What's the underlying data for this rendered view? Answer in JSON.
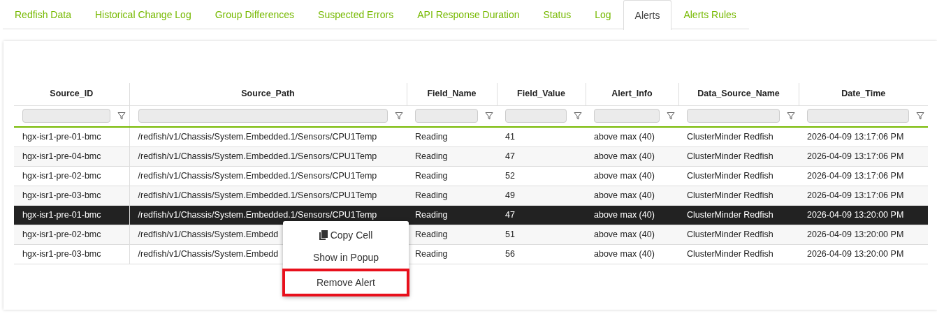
{
  "tabs": [
    {
      "label": "Redfish Data",
      "selected": false
    },
    {
      "label": "Historical Change Log",
      "selected": false
    },
    {
      "label": "Group Differences",
      "selected": false
    },
    {
      "label": "Suspected Errors",
      "selected": false
    },
    {
      "label": "API Response Duration",
      "selected": false
    },
    {
      "label": "Status",
      "selected": false
    },
    {
      "label": "Log",
      "selected": false
    },
    {
      "label": "Alerts",
      "selected": true
    },
    {
      "label": "Alerts Rules",
      "selected": false
    }
  ],
  "table": {
    "columns": [
      "Source_ID",
      "Source_Path",
      "Field_Name",
      "Field_Value",
      "Alert_Info",
      "Data_Source_Name",
      "Date_Time"
    ],
    "rows": [
      {
        "selected": false,
        "cells": [
          "hgx-isr1-pre-01-bmc",
          "/redfish/v1/Chassis/System.Embedded.1/Sensors/CPU1Temp",
          "Reading",
          "41",
          "above max (40)",
          "ClusterMinder Redfish",
          "2026-04-09 13:17:06 PM"
        ]
      },
      {
        "selected": false,
        "cells": [
          "hgx-isr1-pre-04-bmc",
          "/redfish/v1/Chassis/System.Embedded.1/Sensors/CPU1Temp",
          "Reading",
          "47",
          "above max (40)",
          "ClusterMinder Redfish",
          "2026-04-09 13:17:06 PM"
        ]
      },
      {
        "selected": false,
        "cells": [
          "hgx-isr1-pre-02-bmc",
          "/redfish/v1/Chassis/System.Embedded.1/Sensors/CPU1Temp",
          "Reading",
          "52",
          "above max (40)",
          "ClusterMinder Redfish",
          "2026-04-09 13:17:06 PM"
        ]
      },
      {
        "selected": false,
        "cells": [
          "hgx-isr1-pre-03-bmc",
          "/redfish/v1/Chassis/System.Embedded.1/Sensors/CPU1Temp",
          "Reading",
          "49",
          "above max (40)",
          "ClusterMinder Redfish",
          "2026-04-09 13:17:06 PM"
        ]
      },
      {
        "selected": true,
        "cells": [
          "hgx-isr1-pre-01-bmc",
          "/redfish/v1/Chassis/System.Embedded.1/Sensors/CPU1Temp",
          "Reading",
          "47",
          "above max (40)",
          "ClusterMinder Redfish",
          "2026-04-09 13:20:00 PM"
        ]
      },
      {
        "selected": false,
        "cells": [
          "hgx-isr1-pre-02-bmc",
          "/redfish/v1/Chassis/System.Embedd",
          "Reading",
          "51",
          "above max (40)",
          "ClusterMinder Redfish",
          "2026-04-09 13:20:00 PM"
        ]
      },
      {
        "selected": false,
        "cells": [
          "hgx-isr1-pre-03-bmc",
          "/redfish/v1/Chassis/System.Embedd",
          "Reading",
          "56",
          "above max (40)",
          "ClusterMinder Redfish",
          "2026-04-09 13:20:00 PM"
        ]
      }
    ]
  },
  "context_menu": {
    "items": [
      {
        "label": "Copy Cell",
        "kind": "copy",
        "highlighted": false
      },
      {
        "label": "Show in Popup",
        "kind": "plain",
        "highlighted": false
      },
      {
        "label": "Remove Alert",
        "kind": "plain",
        "highlighted": true
      }
    ]
  }
}
